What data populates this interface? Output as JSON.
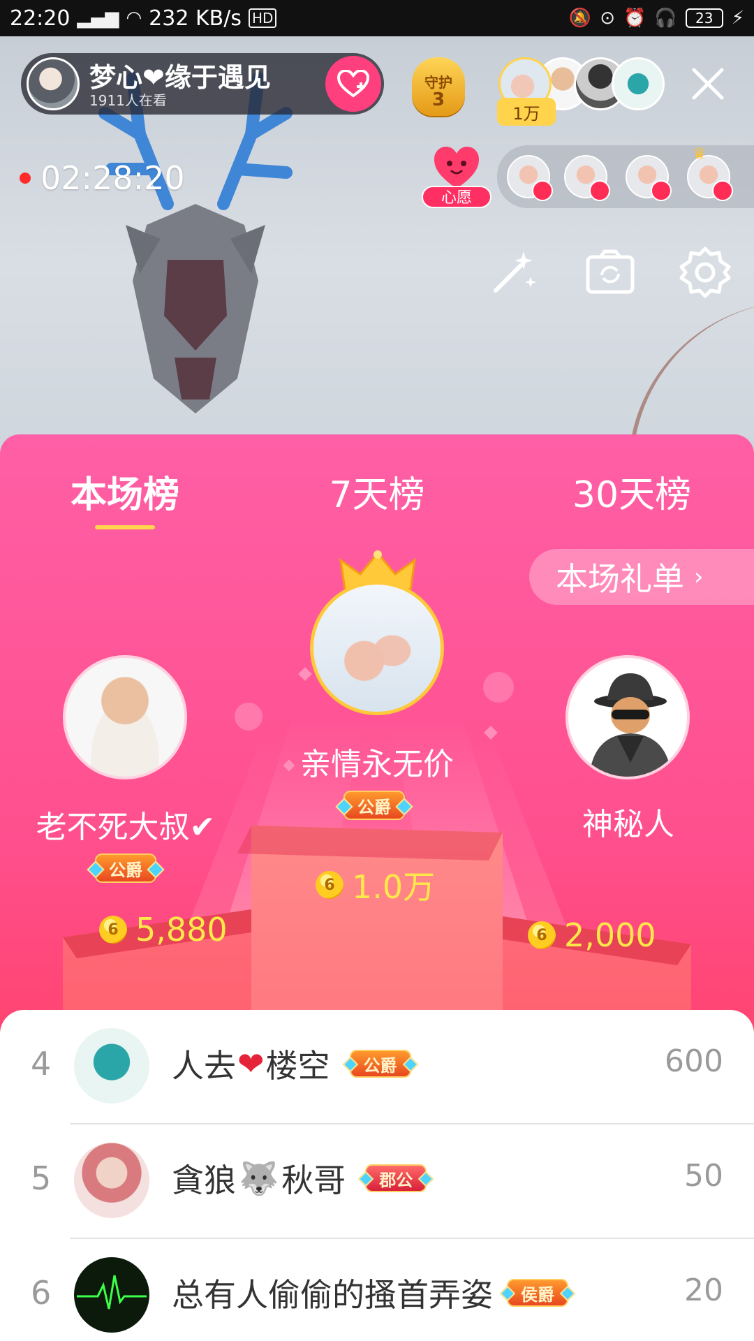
{
  "status_bar": {
    "time": "22:20",
    "network": "4G",
    "speed": "232 KB/s",
    "hd": "HD",
    "battery": "23"
  },
  "live": {
    "anchor_name": "梦心❤缘于遇见",
    "viewers": "1911人在看",
    "guard_label": "守护",
    "guard_count": "3",
    "viewer_count_badge": "1万",
    "duration": "02:28:20",
    "wish_label": "心愿"
  },
  "ranking": {
    "tabs": [
      "本场榜",
      "7天榜",
      "30天榜"
    ],
    "active_tab": 0,
    "gift_list_label": "本场礼单",
    "podium": [
      {
        "place": 1,
        "name": "亲情永无价",
        "badge": "公爵",
        "coins": "1.0万"
      },
      {
        "place": 2,
        "name": "老不死大叔✔",
        "badge": "公爵",
        "coins": "5,880"
      },
      {
        "place": 3,
        "name": "神秘人",
        "badge": "",
        "coins": "2,000"
      }
    ],
    "list": [
      {
        "rank": "4",
        "name_a": "人去",
        "name_b": "楼空",
        "badge": "公爵",
        "score": "600",
        "avatar_color": "#2aa5a8"
      },
      {
        "rank": "5",
        "name_a": "貪狼",
        "name_b": "秋哥",
        "badge": "郡公",
        "score": "50",
        "avatar_color": "#e9b7b0"
      },
      {
        "rank": "6",
        "name_a": "总有人偷偷的搔首弄姿",
        "name_b": "",
        "badge": "侯爵",
        "score": "20",
        "avatar_color": "#0c1a0c"
      }
    ]
  },
  "colors": {
    "panel_top": "#ff5fa6",
    "panel_bottom": "#ff3b4d",
    "coin_text": "#ffe84a",
    "tab_indicator": "#ffd54d"
  },
  "coin_glyph": "6"
}
